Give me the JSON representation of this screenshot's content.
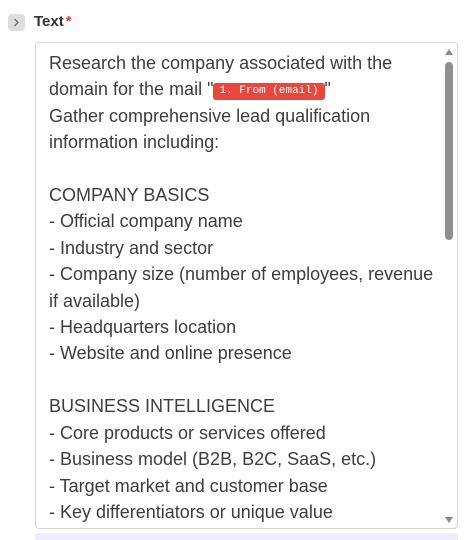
{
  "field": {
    "label": "Text",
    "required_marker": "*"
  },
  "text": {
    "segment_before_chip": "Research the company associated with the domain for the mail \"",
    "chip_label": "1. From (email)",
    "segment_after_chip": "\"\nGather comprehensive lead qualification information including:\n\nCOMPANY BASICS\n- Official company name\n- Industry and sector\n- Company size (number of employees, revenue if available)\n- Headquarters location\n- Website and online presence\n\nBUSINESS INTELLIGENCE\n- Core products or services offered\n- Business model (B2B, B2C, SaaS, etc.)\n- Target market and customer base\n- Key differentiators or unique value"
  },
  "colors": {
    "chip_background": "#e8473e",
    "required_star": "#e0383e",
    "text": "#3d3d3d"
  },
  "icons": {
    "expand": "chevron-right-icon"
  }
}
